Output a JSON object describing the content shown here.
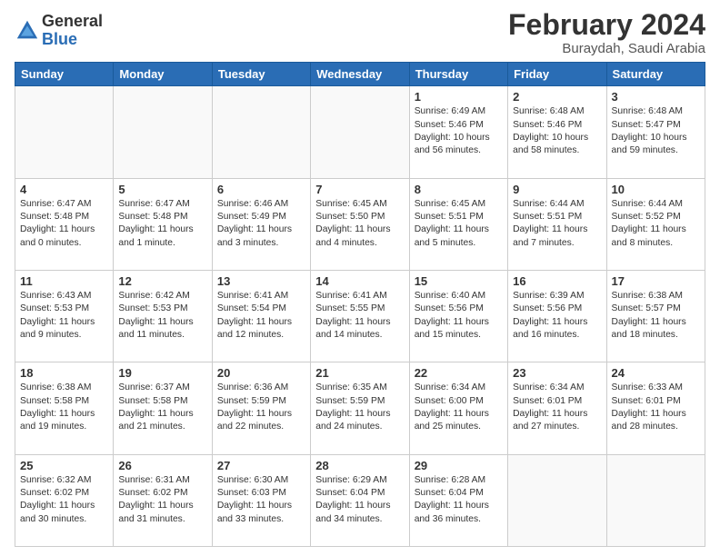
{
  "logo": {
    "general": "General",
    "blue": "Blue"
  },
  "title": {
    "month_year": "February 2024",
    "location": "Buraydah, Saudi Arabia"
  },
  "days_of_week": [
    "Sunday",
    "Monday",
    "Tuesday",
    "Wednesday",
    "Thursday",
    "Friday",
    "Saturday"
  ],
  "weeks": [
    [
      {
        "day": "",
        "info": ""
      },
      {
        "day": "",
        "info": ""
      },
      {
        "day": "",
        "info": ""
      },
      {
        "day": "",
        "info": ""
      },
      {
        "day": "1",
        "info": "Sunrise: 6:49 AM\nSunset: 5:46 PM\nDaylight: 10 hours\nand 56 minutes."
      },
      {
        "day": "2",
        "info": "Sunrise: 6:48 AM\nSunset: 5:46 PM\nDaylight: 10 hours\nand 58 minutes."
      },
      {
        "day": "3",
        "info": "Sunrise: 6:48 AM\nSunset: 5:47 PM\nDaylight: 10 hours\nand 59 minutes."
      }
    ],
    [
      {
        "day": "4",
        "info": "Sunrise: 6:47 AM\nSunset: 5:48 PM\nDaylight: 11 hours\nand 0 minutes."
      },
      {
        "day": "5",
        "info": "Sunrise: 6:47 AM\nSunset: 5:48 PM\nDaylight: 11 hours\nand 1 minute."
      },
      {
        "day": "6",
        "info": "Sunrise: 6:46 AM\nSunset: 5:49 PM\nDaylight: 11 hours\nand 3 minutes."
      },
      {
        "day": "7",
        "info": "Sunrise: 6:45 AM\nSunset: 5:50 PM\nDaylight: 11 hours\nand 4 minutes."
      },
      {
        "day": "8",
        "info": "Sunrise: 6:45 AM\nSunset: 5:51 PM\nDaylight: 11 hours\nand 5 minutes."
      },
      {
        "day": "9",
        "info": "Sunrise: 6:44 AM\nSunset: 5:51 PM\nDaylight: 11 hours\nand 7 minutes."
      },
      {
        "day": "10",
        "info": "Sunrise: 6:44 AM\nSunset: 5:52 PM\nDaylight: 11 hours\nand 8 minutes."
      }
    ],
    [
      {
        "day": "11",
        "info": "Sunrise: 6:43 AM\nSunset: 5:53 PM\nDaylight: 11 hours\nand 9 minutes."
      },
      {
        "day": "12",
        "info": "Sunrise: 6:42 AM\nSunset: 5:53 PM\nDaylight: 11 hours\nand 11 minutes."
      },
      {
        "day": "13",
        "info": "Sunrise: 6:41 AM\nSunset: 5:54 PM\nDaylight: 11 hours\nand 12 minutes."
      },
      {
        "day": "14",
        "info": "Sunrise: 6:41 AM\nSunset: 5:55 PM\nDaylight: 11 hours\nand 14 minutes."
      },
      {
        "day": "15",
        "info": "Sunrise: 6:40 AM\nSunset: 5:56 PM\nDaylight: 11 hours\nand 15 minutes."
      },
      {
        "day": "16",
        "info": "Sunrise: 6:39 AM\nSunset: 5:56 PM\nDaylight: 11 hours\nand 16 minutes."
      },
      {
        "day": "17",
        "info": "Sunrise: 6:38 AM\nSunset: 5:57 PM\nDaylight: 11 hours\nand 18 minutes."
      }
    ],
    [
      {
        "day": "18",
        "info": "Sunrise: 6:38 AM\nSunset: 5:58 PM\nDaylight: 11 hours\nand 19 minutes."
      },
      {
        "day": "19",
        "info": "Sunrise: 6:37 AM\nSunset: 5:58 PM\nDaylight: 11 hours\nand 21 minutes."
      },
      {
        "day": "20",
        "info": "Sunrise: 6:36 AM\nSunset: 5:59 PM\nDaylight: 11 hours\nand 22 minutes."
      },
      {
        "day": "21",
        "info": "Sunrise: 6:35 AM\nSunset: 5:59 PM\nDaylight: 11 hours\nand 24 minutes."
      },
      {
        "day": "22",
        "info": "Sunrise: 6:34 AM\nSunset: 6:00 PM\nDaylight: 11 hours\nand 25 minutes."
      },
      {
        "day": "23",
        "info": "Sunrise: 6:34 AM\nSunset: 6:01 PM\nDaylight: 11 hours\nand 27 minutes."
      },
      {
        "day": "24",
        "info": "Sunrise: 6:33 AM\nSunset: 6:01 PM\nDaylight: 11 hours\nand 28 minutes."
      }
    ],
    [
      {
        "day": "25",
        "info": "Sunrise: 6:32 AM\nSunset: 6:02 PM\nDaylight: 11 hours\nand 30 minutes."
      },
      {
        "day": "26",
        "info": "Sunrise: 6:31 AM\nSunset: 6:02 PM\nDaylight: 11 hours\nand 31 minutes."
      },
      {
        "day": "27",
        "info": "Sunrise: 6:30 AM\nSunset: 6:03 PM\nDaylight: 11 hours\nand 33 minutes."
      },
      {
        "day": "28",
        "info": "Sunrise: 6:29 AM\nSunset: 6:04 PM\nDaylight: 11 hours\nand 34 minutes."
      },
      {
        "day": "29",
        "info": "Sunrise: 6:28 AM\nSunset: 6:04 PM\nDaylight: 11 hours\nand 36 minutes."
      },
      {
        "day": "",
        "info": ""
      },
      {
        "day": "",
        "info": ""
      }
    ]
  ]
}
